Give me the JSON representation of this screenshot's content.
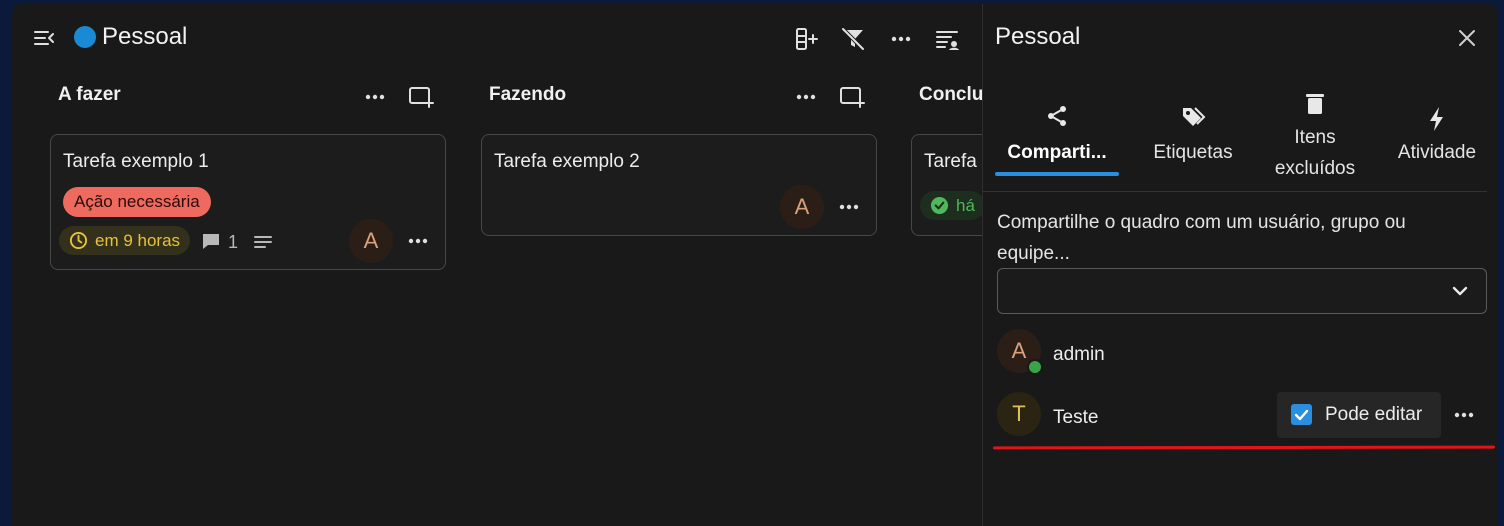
{
  "board": {
    "title": "Pessoal",
    "color": "#1a8ad4"
  },
  "toolbar": {
    "icons": [
      "add-column-icon",
      "filter-off-icon",
      "more-icon",
      "view-options-icon"
    ]
  },
  "columns": [
    {
      "title": "A fazer",
      "cards": [
        {
          "title": "Tarefa exemplo 1",
          "tag": "Ação necessária",
          "due": "em 9 horas",
          "comments": "1",
          "avatar": "A"
        }
      ]
    },
    {
      "title": "Fazendo",
      "cards": [
        {
          "title": "Tarefa exemplo 2",
          "avatar": "A"
        }
      ]
    },
    {
      "title": "Conclu",
      "cards": [
        {
          "title": "Tarefa",
          "done_label": "há"
        }
      ]
    }
  ],
  "panel": {
    "title": "Pessoal",
    "tabs": [
      {
        "label": "Comparti...",
        "icon": "share-icon",
        "active": true
      },
      {
        "label": "Etiquetas",
        "icon": "tag-icon"
      },
      {
        "label": "Itens excluídos",
        "icon": "trash-icon"
      },
      {
        "label": "Atividade",
        "icon": "lightning-icon"
      }
    ],
    "share_prompt": "Compartilhe o quadro com um usuário, grupo ou equipe...",
    "share_select_value": "",
    "users": [
      {
        "initial": "A",
        "name": "admin",
        "online": true
      },
      {
        "initial": "T",
        "name": "Teste",
        "permission": "Pode editar",
        "can_edit": true
      }
    ]
  }
}
